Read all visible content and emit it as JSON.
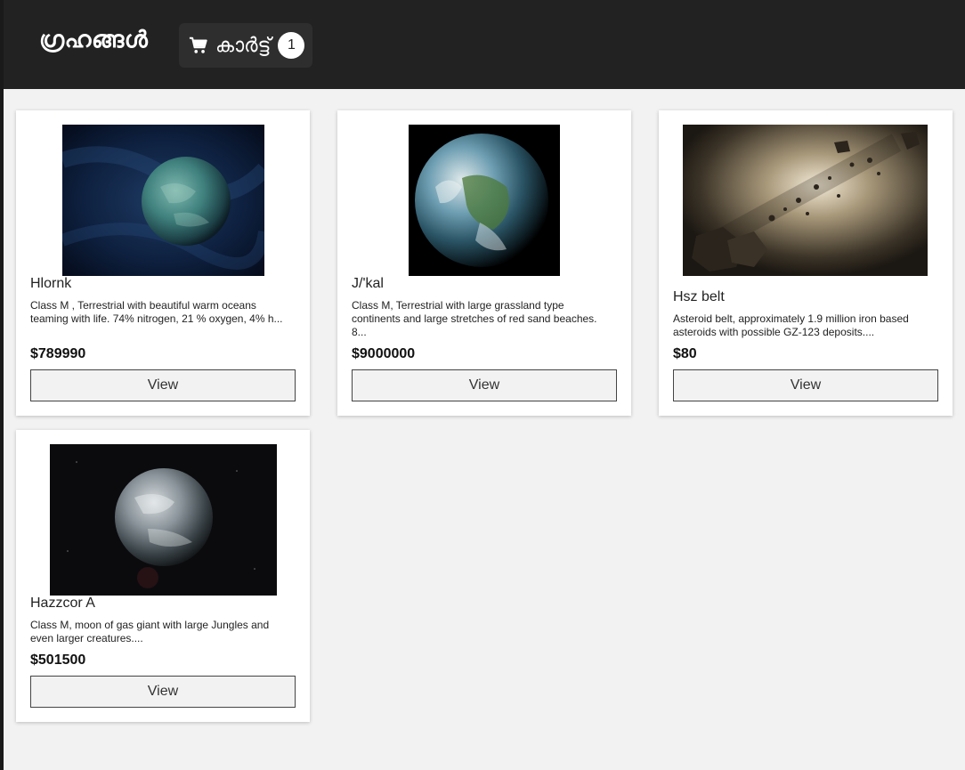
{
  "header": {
    "brand": "ഗ്രഹങ്ങൾ",
    "cart_label": "കാർട്ട്",
    "cart_count": "1"
  },
  "products": [
    {
      "name": "Hlornk",
      "description": "Class M , Terrestrial with beautiful warm oceans teaming with life. 74% nitrogen, 21 % oxygen, 4% h...",
      "price": "$789990",
      "button": "View",
      "image": "ocean-planet-image"
    },
    {
      "name": "J/'kal",
      "description": "Class M, Terrestrial with large grassland type continents and large stretches of red sand beaches. 8...",
      "price": "$9000000",
      "button": "View",
      "image": "earthlike-planet-image"
    },
    {
      "name": "Hsz belt",
      "description": "Asteroid belt, approximately 1.9 million iron based asteroids with possible GZ-123 deposits....",
      "price": "$80",
      "button": "View",
      "image": "asteroid-belt-image"
    },
    {
      "name": "Hazzcor A",
      "description": "Class M, moon of gas giant with large Jungles and even larger creatures....",
      "price": "$501500",
      "button": "View",
      "image": "cloudy-moon-image"
    }
  ],
  "colors": {
    "topbar": "#222222",
    "page_background": "#f2f2f2",
    "card_background": "#ffffff"
  }
}
